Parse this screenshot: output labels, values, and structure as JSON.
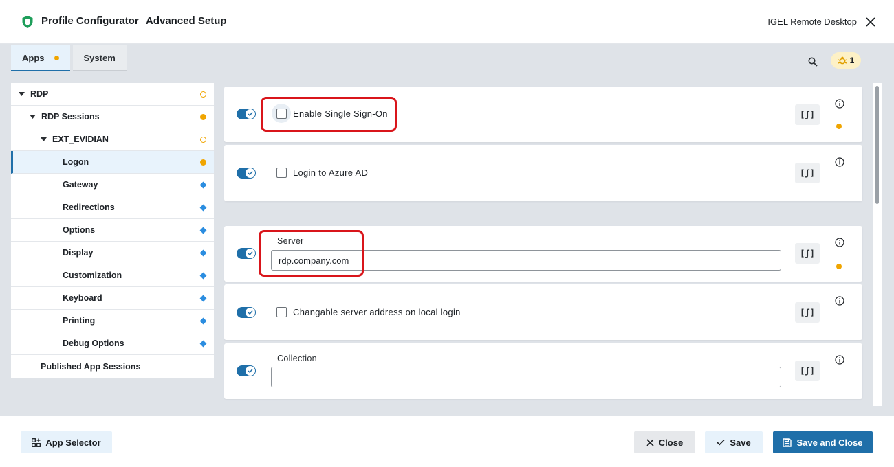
{
  "header": {
    "app_title": "Profile Configurator",
    "setup_title": "Advanced Setup",
    "remote_label": "IGEL Remote Desktop"
  },
  "tabs": [
    {
      "label": "Apps",
      "active": true,
      "modified": true
    },
    {
      "label": "System",
      "active": false,
      "modified": false
    }
  ],
  "notifications": {
    "count": "1",
    "icon": "bug-icon"
  },
  "tree": [
    {
      "label": "RDP",
      "level": 0,
      "expanded": true,
      "status": "ring"
    },
    {
      "label": "RDP Sessions",
      "level": 1,
      "expanded": true,
      "status": "dot"
    },
    {
      "label": "EXT_EVIDIAN",
      "level": 2,
      "expanded": true,
      "status": "ring"
    },
    {
      "label": "Logon",
      "level": 3,
      "selected": true,
      "status": "dot"
    },
    {
      "label": "Gateway",
      "level": 3,
      "status": "diamond"
    },
    {
      "label": "Redirections",
      "level": 3,
      "status": "diamond"
    },
    {
      "label": "Options",
      "level": 3,
      "status": "diamond"
    },
    {
      "label": "Display",
      "level": 3,
      "status": "diamond"
    },
    {
      "label": "Customization",
      "level": 3,
      "status": "diamond"
    },
    {
      "label": "Keyboard",
      "level": 3,
      "status": "diamond"
    },
    {
      "label": "Printing",
      "level": 3,
      "status": "diamond"
    },
    {
      "label": "Debug Options",
      "level": 3,
      "status": "diamond"
    },
    {
      "label": "Published App Sessions",
      "level": 1,
      "status": "none"
    }
  ],
  "settings": {
    "sso": {
      "label": "Enable Single Sign-On",
      "checked": false,
      "enabled": true,
      "modified": true
    },
    "azure": {
      "label": "Login to Azure AD",
      "checked": false,
      "enabled": true,
      "modified": false
    },
    "server": {
      "label": "Server",
      "value": "rdp.company.com",
      "enabled": true,
      "modified": true
    },
    "changeable": {
      "label": "Changable server address on local login",
      "checked": false,
      "enabled": true,
      "modified": false
    },
    "collection": {
      "label": "Collection",
      "value": "",
      "enabled": true,
      "modified": false
    },
    "script_button_label": "[ʃ]"
  },
  "footer": {
    "app_selector": "App Selector",
    "close": "Close",
    "save": "Save",
    "save_and_close": "Save and Close"
  },
  "colors": {
    "accent": "#1f6fa9",
    "modified": "#f0a500",
    "inherited": "#2b8de0",
    "highlight": "#d9151b"
  }
}
